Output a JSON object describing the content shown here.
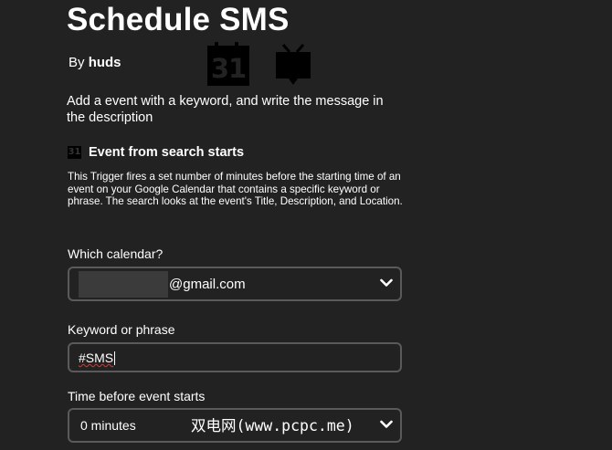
{
  "applet": {
    "title": "Schedule SMS",
    "by_prefix": "By",
    "author": "huds",
    "description": "Add a event with a keyword, and write the message in the description"
  },
  "service_icons": {
    "calendar_icon": "google-calendar-icon",
    "calendar_number": "31",
    "sms_icon": "sms-tv-icon"
  },
  "trigger": {
    "icon_number": "31",
    "title": "Event from search starts",
    "description": "This Trigger fires a set number of minutes before the starting time of an event on your Google Calendar that contains a specific keyword or phrase. The search looks at the event's Title, Description, and Location."
  },
  "fields": {
    "calendar": {
      "label": "Which calendar?",
      "value_suffix": "@gmail.com"
    },
    "keyword": {
      "label": "Keyword or phrase",
      "value": "#SMS"
    },
    "time_before": {
      "label": "Time before event starts",
      "value": "0 minutes"
    }
  },
  "watermark": "双电网(www.pcpc.me)",
  "colors": {
    "background": "#222222",
    "text": "#ffffff",
    "field_border": "#5a5a5a",
    "spellcheck_underline": "#d23a3a"
  }
}
